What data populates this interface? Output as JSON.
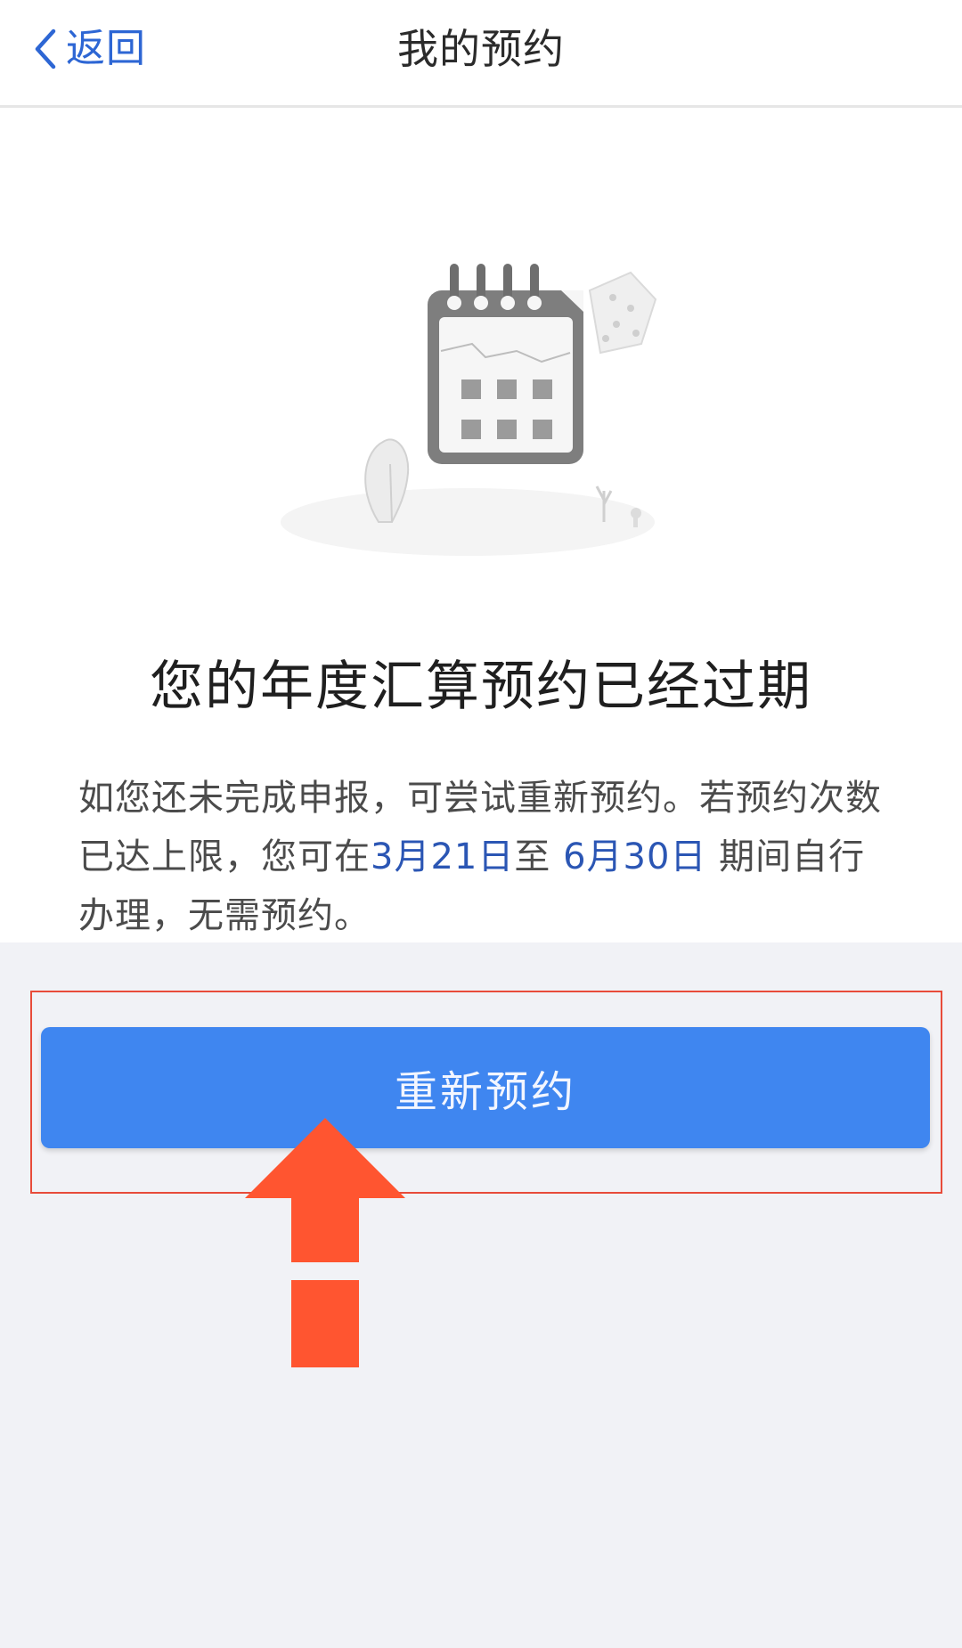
{
  "navbar": {
    "back_label": "返回",
    "title": "我的预约"
  },
  "illustration": {
    "icon": "calendar-icon"
  },
  "main": {
    "headline": "您的年度汇算预约已经过期",
    "desc_part1": "如您还未完成申报，可尝试重新预约。若预约次数已达上限，您可在",
    "date_start": "3月21日",
    "desc_connector": "至",
    "date_end": "6月30日",
    "desc_part2": "期间自行办理，无需预约。"
  },
  "action": {
    "rebook_label": "重新预约"
  },
  "annotation": {
    "arrow_icon": "arrow-up-icon",
    "arrow_color": "#ff5530",
    "box_color": "#e84c3a"
  },
  "colors": {
    "accent": "#3f86f0",
    "link": "#2d66d4",
    "date": "#2b56b4"
  }
}
